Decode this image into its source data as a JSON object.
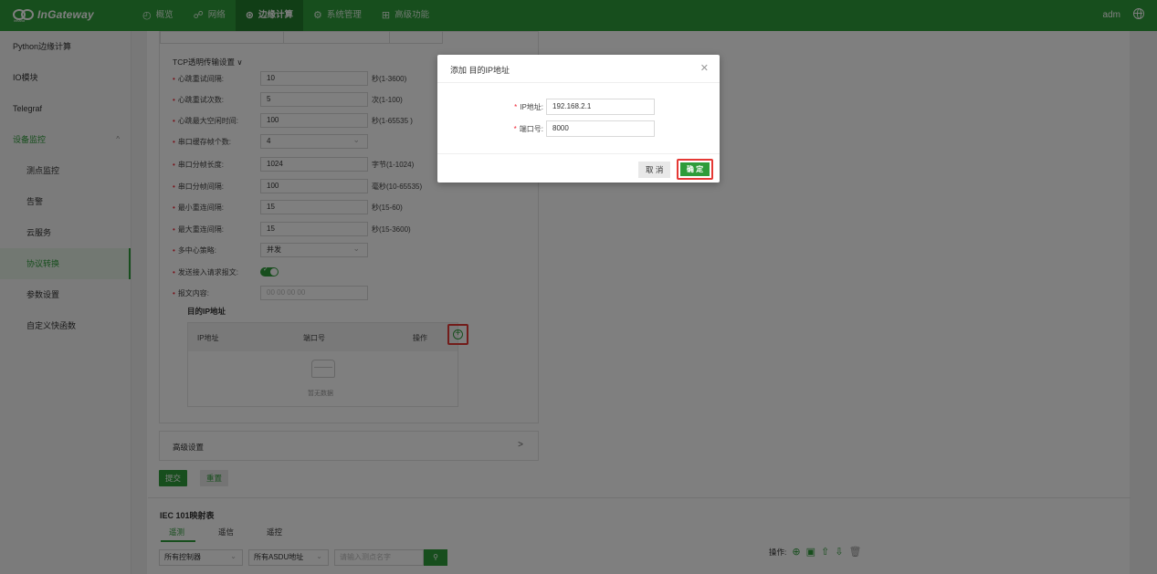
{
  "header": {
    "logo_sub": "inhand",
    "app_name": "InGateway",
    "nav": [
      {
        "label": "概览",
        "icon": "dashboard-icon"
      },
      {
        "label": "网络",
        "icon": "network-icon"
      },
      {
        "label": "边缘计算",
        "icon": "edge-icon"
      },
      {
        "label": "系统管理",
        "icon": "gear-icon"
      },
      {
        "label": "高级功能",
        "icon": "grid-icon"
      }
    ],
    "user": "adm"
  },
  "sidebar": {
    "items": [
      {
        "label": "Python边缘计算"
      },
      {
        "label": "IO模块"
      },
      {
        "label": "Telegraf"
      },
      {
        "label": "设备监控",
        "caret": "^"
      },
      {
        "label": "测点监控"
      },
      {
        "label": "告警"
      },
      {
        "label": "云服务"
      },
      {
        "label": "协议转换"
      },
      {
        "label": "参数设置"
      },
      {
        "label": "自定义快函数"
      }
    ]
  },
  "tcp": {
    "title": "TCP透明传输设置 ∨",
    "rows": [
      {
        "label": "心跳重试间隔:",
        "value": "10",
        "unit": "秒(1-3600)"
      },
      {
        "label": "心跳重试次数:",
        "value": "5",
        "unit": "次(1-100)"
      },
      {
        "label": "心跳最大空闲时间:",
        "value": "100",
        "unit": "秒(1-65535 )"
      },
      {
        "label": "串口缓存帧个数:",
        "value": "4",
        "unit": ""
      },
      {
        "label": "串口分帧长度:",
        "value": "1024",
        "unit": "字节(1-1024)"
      },
      {
        "label": "串口分帧间隔:",
        "value": "100",
        "unit": "毫秒(10-65535)"
      },
      {
        "label": "最小重连间隔:",
        "value": "15",
        "unit": "秒(15-60)"
      },
      {
        "label": "最大重连间隔:",
        "value": "15",
        "unit": "秒(15-3600)"
      },
      {
        "label": "多中心策略:",
        "value": "并发",
        "unit": ""
      },
      {
        "label": "发送接入请求报文:",
        "value": "",
        "unit": ""
      },
      {
        "label": "报文内容:",
        "value": "00 00 00 00",
        "unit": ""
      }
    ]
  },
  "ip_table": {
    "title": "目的IP地址",
    "columns": [
      "IP地址",
      "端口号",
      "操作"
    ],
    "empty_text": "暂无数据"
  },
  "advanced": {
    "label": "高级设置",
    "chevron": ">"
  },
  "actions": {
    "submit": "提交",
    "reset": "重置"
  },
  "iec": {
    "title": "IEC 101映射表",
    "tabs": [
      "遥测",
      "遥信",
      "遥控"
    ],
    "filter_controller": "所有控制器",
    "filter_asdu": "所有ASDU地址",
    "search_placeholder": "请输入测点名字",
    "ops_label": "操作:"
  },
  "modal": {
    "title": "添加 目的IP地址",
    "ip_label": "IP地址:",
    "ip_value": "192.168.2.1",
    "port_label": "端口号:",
    "port_value": "8000",
    "cancel": "取 消",
    "ok": "确 定"
  },
  "colors": {
    "accent": "#2e9c3a",
    "highlight": "#e53935"
  }
}
